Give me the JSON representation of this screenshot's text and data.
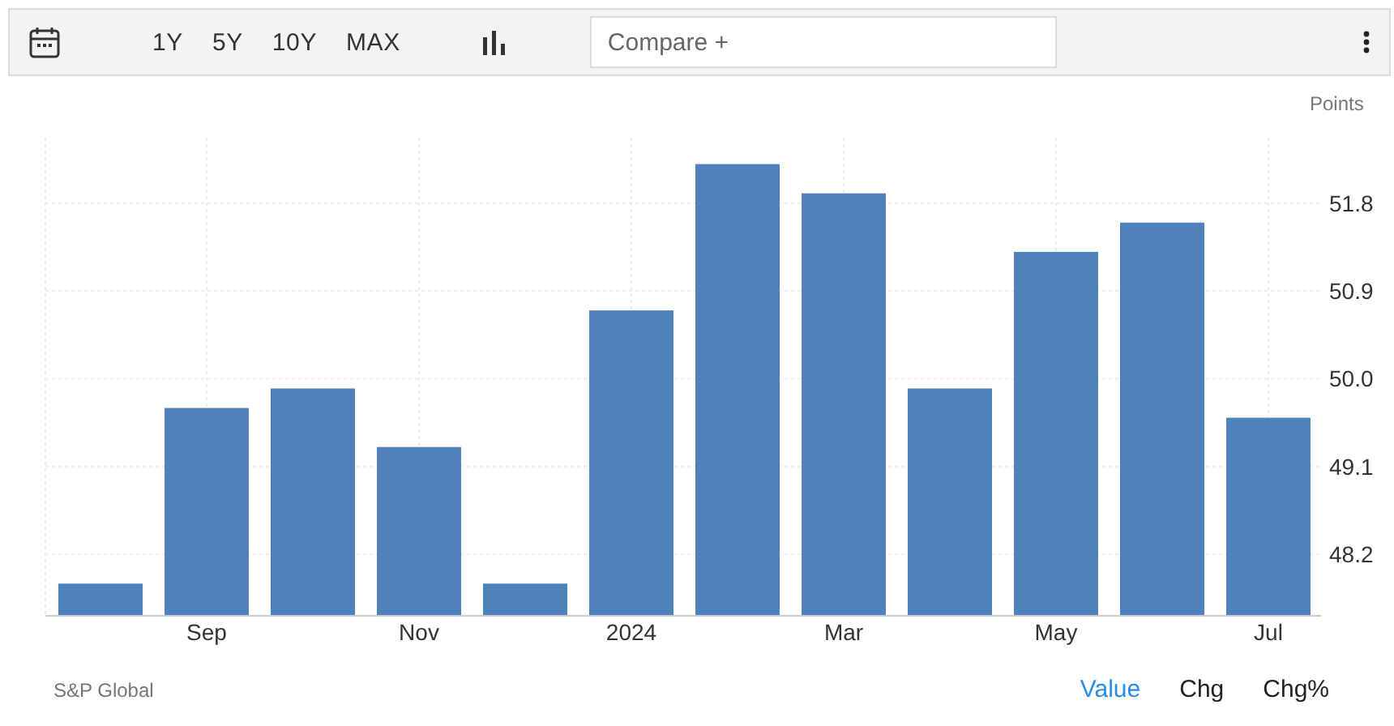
{
  "toolbar": {
    "ranges": [
      {
        "label": "1Y",
        "selected": false
      },
      {
        "label": "5Y",
        "selected": false
      },
      {
        "label": "10Y",
        "selected": false
      },
      {
        "label": "MAX",
        "selected": false
      }
    ],
    "compare": {
      "placeholder": "Compare +"
    }
  },
  "chart": {
    "unit": "Points",
    "chart_data": {
      "type": "bar",
      "grid": true,
      "categories": [
        null,
        "Sep",
        null,
        "Nov",
        null,
        "2024",
        null,
        "Mar",
        null,
        "May",
        null,
        "Jul"
      ],
      "series": [
        {
          "color": "#4f81bd",
          "values": [
            47.9,
            49.7,
            49.9,
            49.3,
            47.9,
            50.7,
            52.2,
            51.9,
            49.9,
            51.3,
            51.6,
            49.6
          ]
        }
      ],
      "ylim": [
        47.57,
        52.47
      ],
      "yticks": [
        48.2,
        49.1,
        {
          "value": 50,
          "label": "50.0"
        },
        50.9,
        51.8
      ]
    }
  },
  "footer": {
    "source": "S&P Global",
    "modes": [
      {
        "label": "Value",
        "selected": true
      },
      {
        "label": "Chg",
        "selected": false
      },
      {
        "label": "Chg%",
        "selected": false
      }
    ]
  }
}
